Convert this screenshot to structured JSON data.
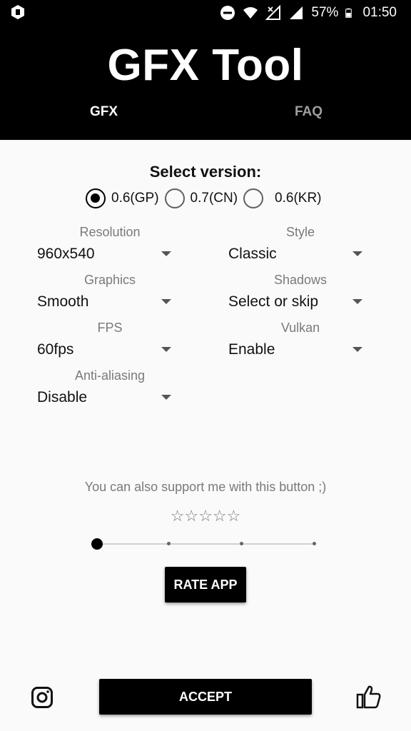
{
  "status_bar": {
    "battery": "57%",
    "time": "01:50",
    "icons": [
      "app-logo-icon",
      "do-not-disturb-icon",
      "wifi-icon",
      "no-signal-icon",
      "signal-icon",
      "battery-icon"
    ]
  },
  "header": {
    "title": "GFX Tool",
    "tabs": [
      {
        "label": "GFX",
        "active": true
      },
      {
        "label": "FAQ",
        "active": false
      }
    ]
  },
  "version": {
    "label": "Select version:",
    "options": [
      {
        "label": "0.6(GP)",
        "checked": true
      },
      {
        "label": "0.7(CN)",
        "checked": false
      },
      {
        "label": "0.6(KR)",
        "checked": false
      }
    ]
  },
  "settings": {
    "resolution": {
      "label": "Resolution",
      "value": "960x540"
    },
    "style": {
      "label": "Style",
      "value": "Classic"
    },
    "graphics": {
      "label": "Graphics",
      "value": "Smooth"
    },
    "shadows": {
      "label": "Shadows",
      "value": "Select or skip"
    },
    "fps": {
      "label": "FPS",
      "value": "60fps"
    },
    "vulkan": {
      "label": "Vulkan",
      "value": "Enable"
    },
    "anti_aliasing": {
      "label": "Anti-aliasing",
      "value": "Disable"
    }
  },
  "support": {
    "text": "You can also support me with this button ;)",
    "stars": "☆☆☆☆☆",
    "slider_value": 0,
    "slider_steps": 4,
    "rate_label": "RATE APP"
  },
  "footer": {
    "accept_label": "ACCEPT",
    "icons": [
      "instagram-icon",
      "thumbs-up-icon"
    ]
  },
  "colors": {
    "primary": "#000000",
    "background": "#fafafa",
    "muted_text": "#7a7a7a"
  }
}
